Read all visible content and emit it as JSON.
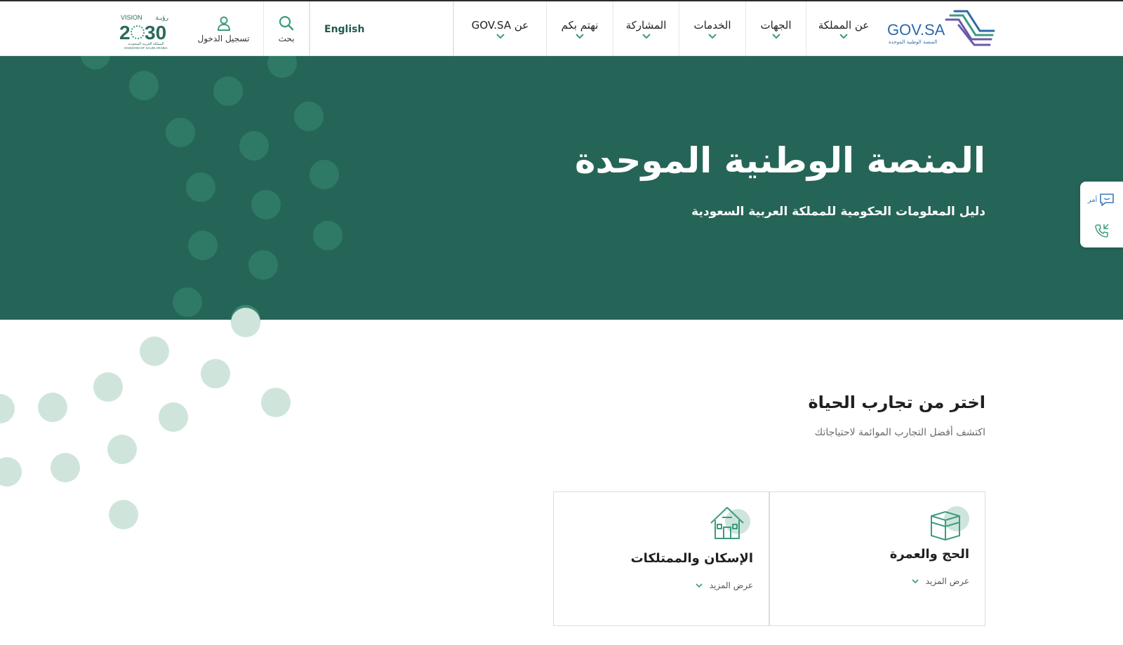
{
  "header": {
    "logo": {
      "title": "GOV.SA",
      "subtitle": "المنصة الوطنية الموحدة"
    },
    "nav": [
      {
        "label": "عن المملكة"
      },
      {
        "label": "الجهات"
      },
      {
        "label": "الخدمات"
      },
      {
        "label": "المشاركة"
      },
      {
        "label": "نهتم بكم"
      },
      {
        "label": "عن GOV.SA"
      }
    ],
    "language_link": "English",
    "search_label": "بحث",
    "login_label": "تسجيل الدخول",
    "vision_logo": {
      "top": "VISION",
      "arabic": "رؤيـة",
      "year_left": "2",
      "year_right": "30",
      "line1": "المملكة العربية السعودية",
      "line2": "KINGDOM OF SAUDI ARABIA"
    }
  },
  "hero": {
    "title": "المنصة الوطنية الموحدة",
    "subtitle": "دليل المعلومات الحكومية للمملكة العربية السعودية"
  },
  "side_widget": {
    "chat_label": "آمر",
    "chat_icon": "chat-icon",
    "call_icon": "phone-call-icon"
  },
  "life_section": {
    "title": "اختر من تجارب الحياة",
    "subtitle": "اكتشف أفضل التجارب الموائمة لاحتياجاتك",
    "cards": [
      {
        "title": "الحج والعمرة",
        "more": "عرض المزيد",
        "icon": "kaaba-icon"
      },
      {
        "title": "الإسكان والممتلكات",
        "more": "عرض المزيد",
        "icon": "house-icon"
      }
    ]
  },
  "colors": {
    "brand_green": "#256558",
    "accent_green": "#3d9a80",
    "dots_dark": "#2f7a67",
    "dots_light": "#cfe5dc",
    "logo_blue": "#2d6aa8",
    "logo_purple": "#6a5aa8"
  }
}
